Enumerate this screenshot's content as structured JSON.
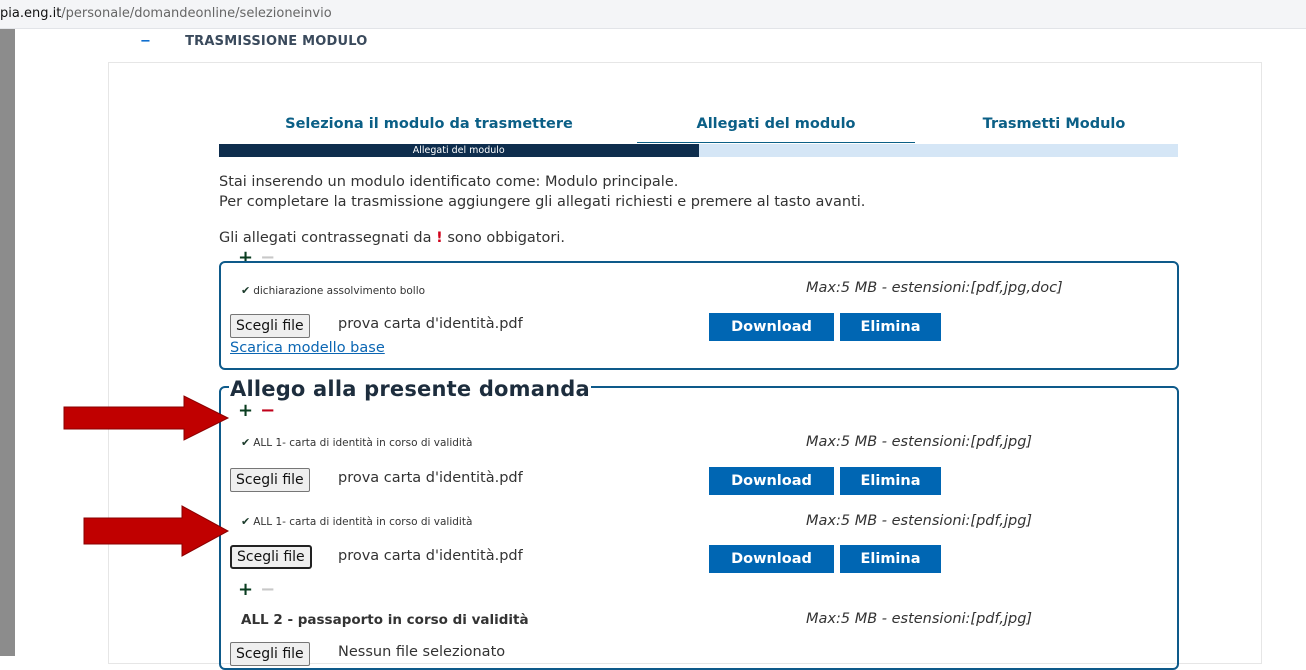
{
  "browser": {
    "url_host": "pia.eng.it",
    "url_path": "/personale/domandeonline/selezioneinvio"
  },
  "section": {
    "toggle": "−",
    "title": "TRASMISSIONE MODULO"
  },
  "wizard": {
    "tabs": [
      {
        "label": "Seleziona il modulo da trasmettere"
      },
      {
        "label": "Allegati del modulo"
      },
      {
        "label": "Trasmetti Modulo"
      }
    ],
    "progress_label": "Allegati del modulo",
    "progress_fraction": 0.5
  },
  "intro": {
    "line1": "Stai inserendo un modulo identificato come: Modulo principale.",
    "line2": "Per completare la trasmissione aggiungere gli allegati richiesti e premere al tasto avanti.",
    "note_before": "Gli allegati contrassegnati da",
    "note_mark": "!",
    "note_after": "sono obbigatori."
  },
  "controls": {
    "plus": "+",
    "minus": "−",
    "check": "✔"
  },
  "box1": {
    "item_label": "dichiarazione assolvimento bollo",
    "max": "Max:5 MB - estensioni:[pdf,jpg,doc]",
    "choose_file": "Scegli file",
    "file_name": "prova carta d'identità.pdf",
    "download": "Download",
    "delete": "Elimina",
    "template_link": "Scarica modello base"
  },
  "box2": {
    "title": "Allego alla presente domanda",
    "rows": [
      {
        "label": "ALL 1- carta di identità in corso di validità",
        "max": "Max:5 MB - estensioni:[pdf,jpg]",
        "choose_file": "Scegli file",
        "file_name": "prova carta d'identità.pdf",
        "download": "Download",
        "delete": "Elimina"
      },
      {
        "label": "ALL 1- carta di identità in corso di validità",
        "max": "Max:5 MB - estensioni:[pdf,jpg]",
        "choose_file": "Scegli file",
        "file_name": "prova carta d'identità.pdf",
        "download": "Download",
        "delete": "Elimina"
      }
    ],
    "all2": {
      "label": "ALL 2 - passaporto in corso di validità",
      "max": "Max:5 MB - estensioni:[pdf,jpg]",
      "choose_file": "Scegli file",
      "file_name": "Nessun file selezionato"
    }
  },
  "colors": {
    "arrow": "#c00000",
    "primary_button": "#0066b3",
    "box_border": "#0e5a8a",
    "progress_fill": "#0e2d4d"
  }
}
